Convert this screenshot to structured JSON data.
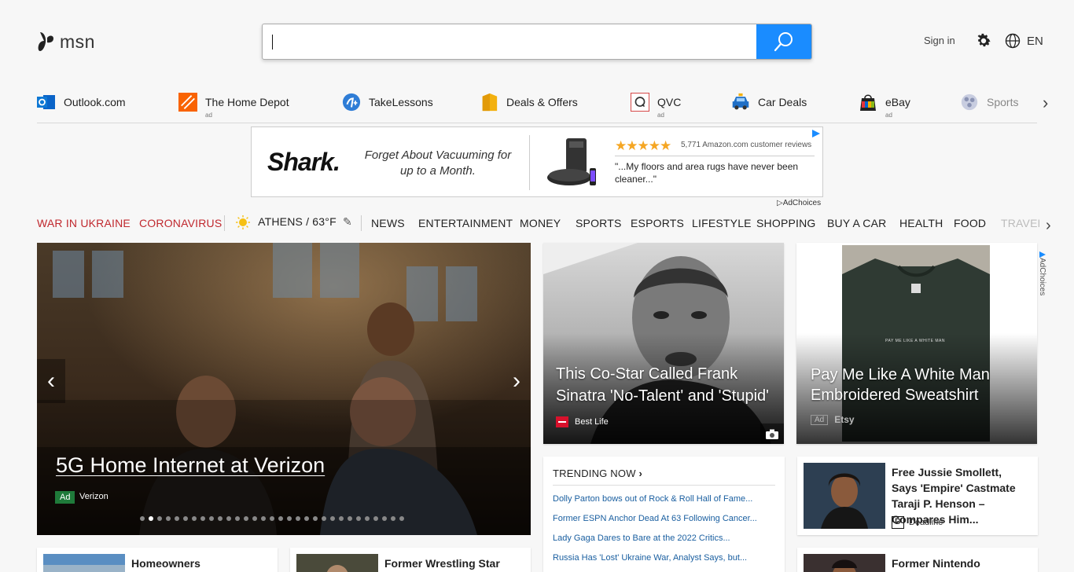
{
  "header": {
    "logo_text": "msn",
    "search_value": "",
    "sign_in": "Sign in",
    "language": "EN"
  },
  "quicklinks": [
    {
      "label": "Outlook.com",
      "ad": "",
      "icon": "outlook-icon"
    },
    {
      "label": "The Home Depot",
      "ad": "ad",
      "icon": "home-depot-icon"
    },
    {
      "label": "TakeLessons",
      "ad": "",
      "icon": "takelessons-icon"
    },
    {
      "label": "Deals & Offers",
      "ad": "",
      "icon": "deals-icon"
    },
    {
      "label": "QVC",
      "ad": "ad",
      "icon": "qvc-icon"
    },
    {
      "label": "Car Deals",
      "ad": "",
      "icon": "car-icon"
    },
    {
      "label": "eBay",
      "ad": "ad",
      "icon": "ebay-icon"
    },
    {
      "label": "Sports",
      "ad": "",
      "icon": "sports-icon"
    }
  ],
  "banner": {
    "brand": "Shark.",
    "tagline": "Forget About Vacuuming for up to a Month.",
    "reviews": "5,771 Amazon.com customer reviews",
    "quote": "\"...My floors and area rugs have never been cleaner...\"",
    "adchoices": "AdChoices"
  },
  "nav": {
    "war": "WAR IN UKRAINE",
    "corona": "CORONAVIRUS",
    "weather": "ATHENS / 63°F",
    "items": [
      "NEWS",
      "ENTERTAINMENT",
      "MONEY",
      "SPORTS",
      "ESPORTS",
      "LIFESTYLE",
      "SHOPPING",
      "BUY A CAR",
      "HEALTH",
      "FOOD",
      "TRAVEL"
    ]
  },
  "hero": {
    "title": "5G Home Internet at Verizon",
    "ad_label": "Ad",
    "source": "Verizon"
  },
  "card1": {
    "headline": "This Co-Star Called Frank Sinatra 'No-Talent' and 'Stupid'",
    "source": "Best Life"
  },
  "card2": {
    "headline": "Pay Me Like A White Man Embroidered Sweatshirt",
    "ad_label": "Ad",
    "source": "Etsy",
    "shirt_print": "PAY ME LIKE A WHITE MAN",
    "adchoices": "AdChoices"
  },
  "trending": {
    "title": "TRENDING NOW",
    "items": [
      "Dolly Parton bows out of Rock & Roll Hall of Fame...",
      "Former ESPN Anchor Dead At 63 Following Cancer...",
      "Lady Gaga Dares to Bare at the 2022 Critics...",
      "Russia Has 'Lost' Ukraine War, Analyst Says, but..."
    ]
  },
  "story1": {
    "title": "Free Jussie Smollett, Says 'Empire' Castmate Taraji P. Henson – Compares Him...",
    "source": "Deadline"
  },
  "story2": {
    "title": "Former Nintendo America"
  },
  "bottom1": {
    "title": "Homeowners Encouraged to"
  },
  "bottom2": {
    "title": "Former Wrestling Star Scott"
  }
}
